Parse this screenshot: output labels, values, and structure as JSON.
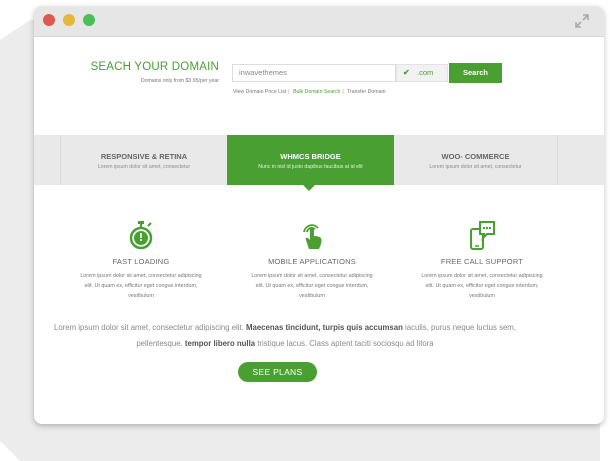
{
  "colors": {
    "accent": "#4a9f32",
    "tab_bg": "#e9e9e9",
    "titlebar": "#e6e6e6",
    "close": "#e0584d",
    "minimize": "#e1b93b",
    "maximize": "#4cbf58"
  },
  "search": {
    "title": "SEACH YOUR DOMAIN",
    "subtitle": "Domains only from $3.95/per year",
    "input_value": "inwavethemes",
    "tld": ".com",
    "button": "Search",
    "links": [
      "View Domain Price List",
      "Bulk Domain Search",
      "Transfer Domain"
    ]
  },
  "tabs": [
    {
      "title": "RESPONSIVE & RETINA",
      "subtitle": "Lorem ipsum dolor sit amet, consectetur"
    },
    {
      "title": "WHMCS BRIDGE",
      "subtitle": "Nunc in nisl id justo dapibus faucibus at id elit"
    },
    {
      "title": "WOO- COMMERCE",
      "subtitle": "Lorem ipsum dolor sit amet, consectetur"
    }
  ],
  "features": [
    {
      "icon": "stopwatch-icon",
      "title": "FAST LOADING",
      "desc_1": "Lorem ipsum dolor sit amet, consectetur adipiscing",
      "desc_2": "elit. Ut quam ex, efficitur eget congue interdum,",
      "desc_3": "vestibulum"
    },
    {
      "icon": "touch-hand-icon",
      "title": "MOBILE APPLICATIONS",
      "desc_1": "Lorem ipsum dolor sit amet, consectetur adipiscing",
      "desc_2": "elit. Ut quam ex, efficitur eget congue interdum,",
      "desc_3": "vestibulum"
    },
    {
      "icon": "phone-chat-icon",
      "title": "FREE CALL SUPPORT",
      "desc_1": "Lorem ipsum dolor sit amet, consectetur adipiscing",
      "desc_2": "elit. Ut quam ex, efficitur eget congue interdum,",
      "desc_3": "vestibulum"
    }
  ],
  "intro": {
    "part1": "Lorem ipsum dolor sit amet, consectetur adipiscing elit. ",
    "bold1": "Maecenas tincidunt, turpis quis accumsan",
    "part2": " iaculis, purus neque luctus sem, pellentesque. ",
    "bold2": "tempor libero nulla",
    "part3": " tristique lacus. Class aptent taciti sociosqu ad litora"
  },
  "cta": {
    "label": "SEE PLANS"
  }
}
